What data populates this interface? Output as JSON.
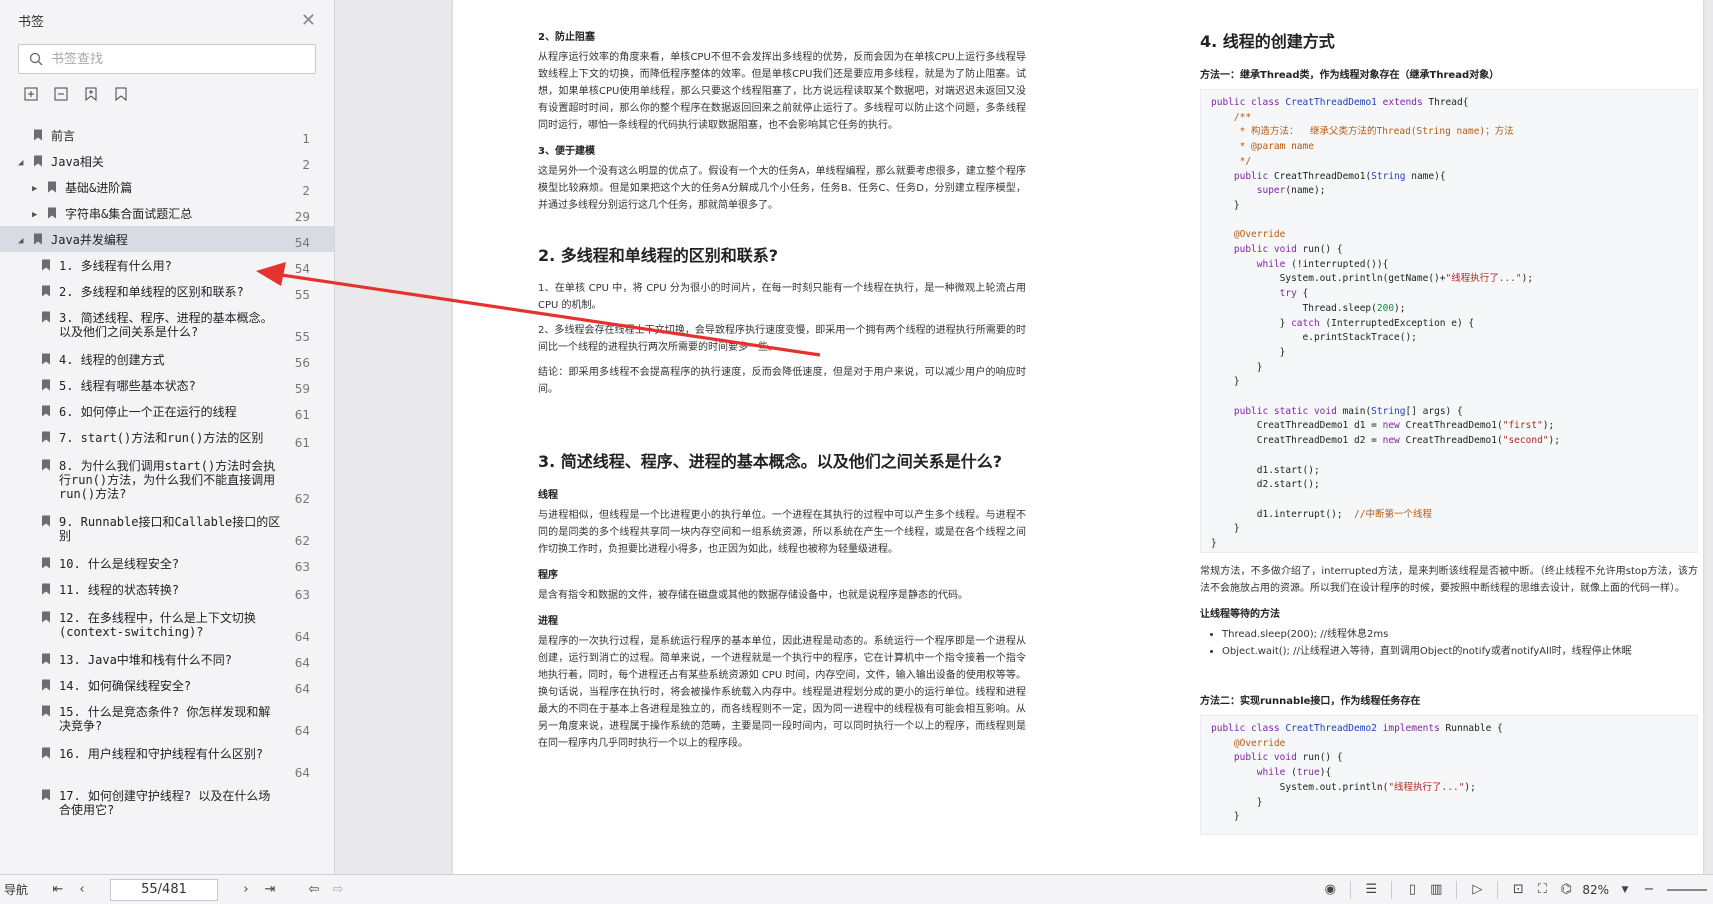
{
  "sidebar": {
    "title": "书签",
    "search_placeholder": "书签查找",
    "items": [
      {
        "label": "前言",
        "page": "1",
        "level": 0,
        "caret": ""
      },
      {
        "label": "Java相关",
        "page": "2",
        "level": 0,
        "caret": "▲"
      },
      {
        "label": "基础&进阶篇",
        "page": "2",
        "level": 1,
        "caret": "▶"
      },
      {
        "label": "字符串&集合面试题汇总",
        "page": "29",
        "level": 1,
        "caret": "▶"
      },
      {
        "label": "Java并发编程",
        "page": "54",
        "level": 0,
        "caret": "▲"
      },
      {
        "label": "1. 多线程有什么用?",
        "page": "54",
        "level": 2,
        "caret": ""
      },
      {
        "label": "2. 多线程和单线程的区别和联系?",
        "page": "55",
        "level": 2,
        "caret": ""
      },
      {
        "label": "3. 简述线程、程序、进程的基本概念。以及他们之间关系是什么?",
        "page": "55",
        "level": 2,
        "caret": ""
      },
      {
        "label": "4. 线程的创建方式",
        "page": "56",
        "level": 2,
        "caret": ""
      },
      {
        "label": "5. 线程有哪些基本状态?",
        "page": "59",
        "level": 2,
        "caret": ""
      },
      {
        "label": "6. 如何停止一个正在运行的线程",
        "page": "61",
        "level": 2,
        "caret": ""
      },
      {
        "label": "7. start()方法和run()方法的区别",
        "page": "61",
        "level": 2,
        "caret": ""
      },
      {
        "label": "8. 为什么我们调用start()方法时会执行run()方法，为什么我们不能直接调用run()方法?",
        "page": "62",
        "level": 2,
        "caret": ""
      },
      {
        "label": "9. Runnable接口和Callable接口的区别",
        "page": "62",
        "level": 2,
        "caret": ""
      },
      {
        "label": "10. 什么是线程安全?",
        "page": "63",
        "level": 2,
        "caret": ""
      },
      {
        "label": "11. 线程的状态转换?",
        "page": "63",
        "level": 2,
        "caret": ""
      },
      {
        "label": "12. 在多线程中，什么是上下文切换(context-switching)?",
        "page": "64",
        "level": 2,
        "caret": ""
      },
      {
        "label": "13. Java中堆和栈有什么不同?",
        "page": "64",
        "level": 2,
        "caret": ""
      },
      {
        "label": "14. 如何确保线程安全?",
        "page": "64",
        "level": 2,
        "caret": ""
      },
      {
        "label": "15. 什么是竞态条件? 你怎样发现和解决竞争?",
        "page": "64",
        "level": 2,
        "caret": ""
      },
      {
        "label": "16. 用户线程和守护线程有什么区别?",
        "page": "64",
        "level": 2,
        "caret": ""
      },
      {
        "label": "17. 如何创建守护线程? 以及在什么场合使用它?",
        "page": "",
        "level": 2,
        "caret": ""
      }
    ]
  },
  "doc": {
    "left": {
      "s2_title": "2、防止阻塞",
      "s2_body": "从程序运行效率的角度来看，单核CPU不但不会发挥出多线程的优势，反而会因为在单核CPU上运行多线程导致线程上下文的切换，而降低程序整体的效率。但是单核CPU我们还是要应用多线程，就是为了防止阻塞。试想，如果单核CPU使用单线程，那么只要这个线程阻塞了，比方说远程读取某个数据吧，对端迟迟未返回又没有设置超时时间，那么你的整个程序在数据返回回来之前就停止运行了。多线程可以防止这个问题，多条线程同时运行，哪怕一条线程的代码执行读取数据阻塞，也不会影响其它任务的执行。",
      "s3_title": "3、便于建模",
      "s3_body": "这是另外一个没有这么明显的优点了。假设有一个大的任务A，单线程编程，那么就要考虑很多，建立整个程序模型比较麻烦。但是如果把这个大的任务A分解成几个小任务，任务B、任务C、任务D，分别建立程序模型，并通过多线程分别运行这几个任务，那就简单很多了。",
      "h2_title": "2. 多线程和单线程的区别和联系?",
      "h2_p1": "1、在单核 CPU 中，将 CPU 分为很小的时间片，在每一时刻只能有一个线程在执行，是一种微观上轮流占用 CPU 的机制。",
      "h2_p2": "2、多线程会存在线程上下文切换，会导致程序执行速度变慢，即采用一个拥有两个线程的进程执行所需要的时间比一个线程的进程执行两次所需要的时间要多一些。",
      "h2_p3": "结论：即采用多线程不会提高程序的执行速度，反而会降低速度，但是对于用户来说，可以减少用户的响应时间。",
      "h3_title": "3. 简述线程、程序、进程的基本概念。以及他们之间关系是什么?",
      "thread_label": "线程",
      "thread_body": "与进程相似，但线程是一个比进程更小的执行单位。一个进程在其执行的过程中可以产生多个线程。与进程不同的是同类的多个线程共享同一块内存空间和一组系统资源，所以系统在产生一个线程，或是在各个线程之间作切换工作时，负担要比进程小得多，也正因为如此，线程也被称为轻量级进程。",
      "program_label": "程序",
      "program_body": "是含有指令和数据的文件，被存储在磁盘或其他的数据存储设备中，也就是说程序是静态的代码。",
      "process_label": "进程",
      "process_body": "是程序的一次执行过程，是系统运行程序的基本单位，因此进程是动态的。系统运行一个程序即是一个进程从创建，运行到消亡的过程。简单来说，一个进程就是一个执行中的程序，它在计算机中一个指令接着一个指令地执行着，同时，每个进程还占有某些系统资源如 CPU 时间，内存空间，文件，输入输出设备的使用权等等。换句话说，当程序在执行时，将会被操作系统载入内存中。线程是进程划分成的更小的运行单位。线程和进程最大的不同在于基本上各进程是独立的，而各线程则不一定，因为同一进程中的线程极有可能会相互影响。从另一角度来说，进程属于操作系统的范畴，主要是同一段时间内，可以同时执行一个以上的程序，而线程则是在同一程序内几乎同时执行一个以上的程序段。"
    },
    "right": {
      "h2_title": "4. 线程的创建方式",
      "method1": "方法一：继承Thread类，作为线程对象存在（继承Thread对象）",
      "after_code": "常规方法，不多做介绍了，interrupted方法，是来判断该线程是否被中断。（终止线程不允许用stop方法，该方法不会施放占用的资源。所以我们在设计程序的时候，要按照中断线程的思维去设计，就像上面的代码一样）。",
      "wait_title": "让线程等待的方法",
      "bullet1": "Thread.sleep(200); //线程休息2ms",
      "bullet2": "Object.wait();   //让线程进入等待，直到调用Object的notify或者notifyAll时，线程停止休眠",
      "method2": "方法二：实现runnable接口，作为线程任务存在"
    }
  },
  "bottombar": {
    "nav_label": "导航",
    "page_indicator": "55/481",
    "zoom": "82%"
  },
  "colors": {
    "arrow": "#e5322d",
    "selected_bg": "#d8dbe3"
  }
}
